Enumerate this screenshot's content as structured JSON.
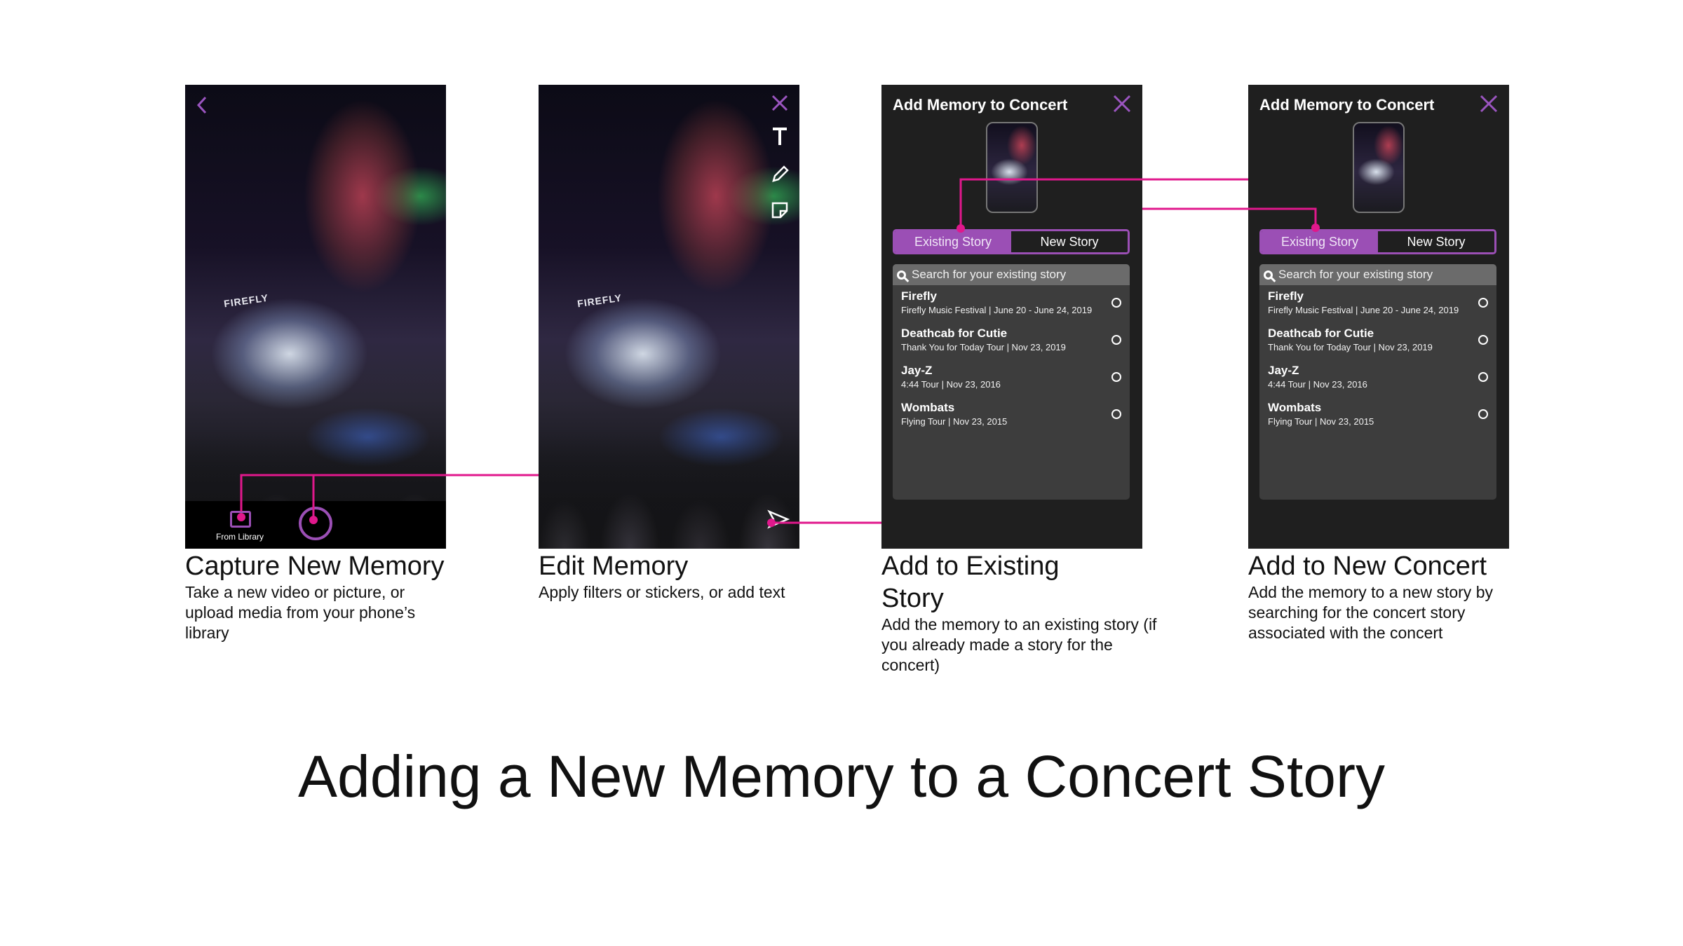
{
  "colors": {
    "accent": "#9b4fb5",
    "connector": "#e0188c",
    "screen_bg": "#1f1f1f",
    "list_bg": "#3d3d3d"
  },
  "screen1": {
    "back_icon": "chevron-left-icon",
    "sign_text": "FIREFLY",
    "library_label": "From Library",
    "caption_title": "Capture New Memory",
    "caption_desc": "Take a new video or picture, or upload media from your phone’s library"
  },
  "screen2": {
    "sign_text": "FIREFLY",
    "tools": [
      "close-icon",
      "text-icon",
      "pencil-icon",
      "sticker-icon",
      "send-icon"
    ],
    "caption_title": "Edit Memory",
    "caption_desc": "Apply filters or stickers, or add text"
  },
  "screen3": {
    "title": "Add Memory to Concert",
    "tab_existing": "Existing Story",
    "tab_new": "New Story",
    "search_placeholder": "Search for your existing story",
    "items": [
      {
        "title": "Firefly",
        "subtitle": "Firefly Music Festival | June 20 - June 24, 2019"
      },
      {
        "title": "Deathcab for Cutie",
        "subtitle": "Thank You for Today Tour | Nov 23, 2019"
      },
      {
        "title": "Jay-Z",
        "subtitle": "4:44 Tour | Nov 23, 2016"
      },
      {
        "title": "Wombats",
        "subtitle": "Flying Tour | Nov 23, 2015"
      }
    ],
    "caption_title": "Add to Existing Story",
    "caption_desc": "Add the memory to an existing story (if you already made a story for the concert)"
  },
  "screen4": {
    "title": "Add Memory to Concert",
    "tab_existing": "Existing Story",
    "tab_new": "New Story",
    "search_placeholder": "Search for your existing story",
    "items": [
      {
        "title": "Firefly",
        "subtitle": "Firefly Music Festival | June 20 - June 24, 2019"
      },
      {
        "title": "Deathcab for Cutie",
        "subtitle": "Thank You for Today Tour | Nov 23, 2019"
      },
      {
        "title": "Jay-Z",
        "subtitle": "4:44 Tour | Nov 23, 2016"
      },
      {
        "title": "Wombats",
        "subtitle": "Flying Tour | Nov 23, 2015"
      }
    ],
    "caption_title": "Add to New Concert",
    "caption_desc": "Add the memory to a new story by searching for the concert story associated with the concert"
  },
  "main_title": "Adding a New Memory to a Concert Story"
}
